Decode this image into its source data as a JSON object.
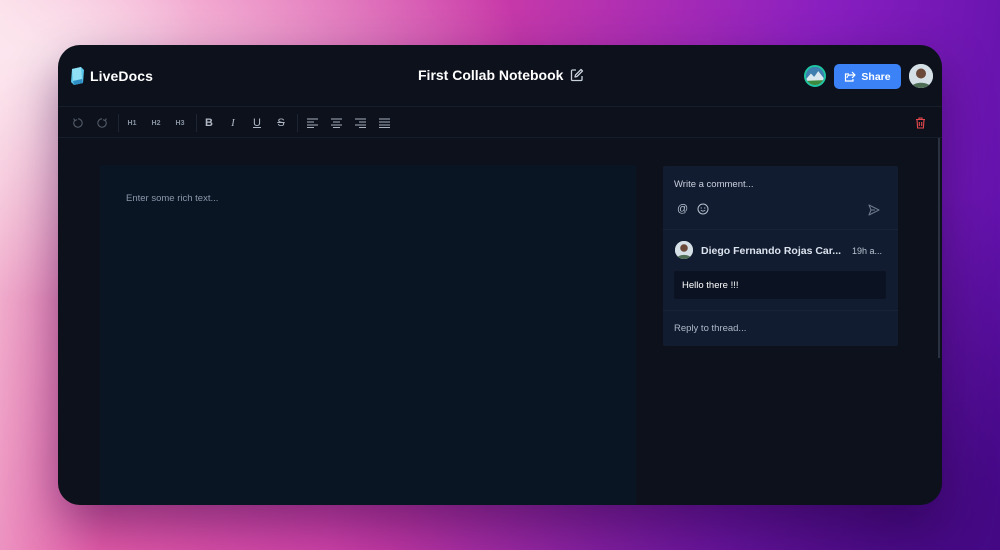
{
  "app": {
    "name": "LiveDocs"
  },
  "document": {
    "title": "First Collab Notebook"
  },
  "header": {
    "share_label": "Share"
  },
  "toolbar": {
    "undo": "undo-icon",
    "redo": "redo-icon",
    "h1": "H1",
    "h2": "H2",
    "h3": "H3",
    "bold": "B",
    "italic": "I",
    "underline": "U",
    "strike": "S"
  },
  "editor": {
    "placeholder": "Enter some rich text..."
  },
  "comments": {
    "input_placeholder": "Write a comment...",
    "thread": {
      "author": "Diego Fernando Rojas Car...",
      "time": "19h a...",
      "body": "Hello there !!!"
    },
    "reply_placeholder": "Reply to thread..."
  },
  "colors": {
    "accent": "#3b82f6",
    "window_bg": "#0c111b",
    "editor_bg": "#0a1524",
    "comments_bg": "#111c30",
    "danger": "#e5484d"
  }
}
